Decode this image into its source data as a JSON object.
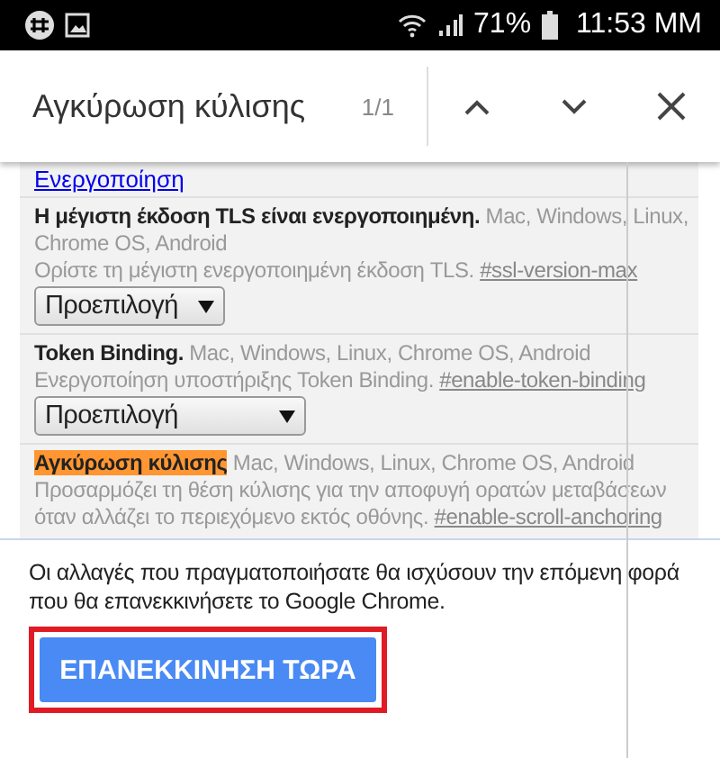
{
  "status_bar": {
    "battery": "71%",
    "time": "11:53 ΜΜ"
  },
  "find_bar": {
    "query": "Αγκύρωση κύλισης",
    "count": "1/1"
  },
  "top_link": "Ενεργοποίηση",
  "flags": [
    {
      "title": "Η μέγιστη έκδοση TLS είναι ενεργοποιημένη.",
      "highlighted": false,
      "platforms": "Mac, Windows, Linux, Chrome OS, Android",
      "description": "Ορίστε τη μέγιστη ενεργοποιημένη έκδοση TLS.",
      "anchor": "#ssl-version-max",
      "select": "Προεπιλογή",
      "select_wide": false
    },
    {
      "title": "Token Binding.",
      "highlighted": false,
      "platforms": "Mac, Windows, Linux, Chrome OS, Android",
      "description": "Ενεργοποίηση υποστήριξης Token Binding.",
      "anchor": "#enable-token-binding",
      "select": "Προεπιλογή",
      "select_wide": true
    },
    {
      "title": "Αγκύρωση κύλισης",
      "highlighted": true,
      "platforms": "Mac, Windows, Linux, Chrome OS, Android",
      "description": "Προσαρμόζει τη θέση κύλισης για την αποφυγή ορατών μεταβάσεων όταν αλλάζει το περιεχόμενο εκτός οθόνης.",
      "anchor": "#enable-scroll-anchoring"
    }
  ],
  "relaunch": {
    "message": "Οι αλλαγές που πραγματοποιήσατε θα ισχύσουν την επόμενη φορά που θα επανεκκινήσετε το Google Chrome.",
    "button": "ΕΠΑΝΕΚΚΙΝΗΣΗ ΤΩΡΑ"
  }
}
